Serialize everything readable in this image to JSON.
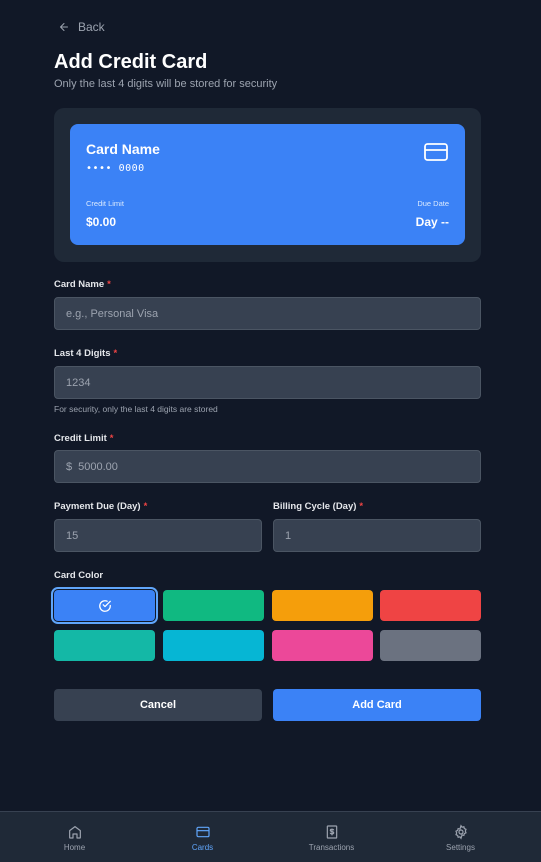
{
  "header": {
    "back_label": "Back",
    "title": "Add Credit Card",
    "subtitle": "Only the last 4 digits will be stored for security"
  },
  "preview": {
    "name": "Card Name",
    "number": "•••• 0000",
    "limit_label": "Credit Limit",
    "limit_value": "$0.00",
    "due_label": "Due Date",
    "due_value": "Day --",
    "icon": "credit-card-icon",
    "color": "#3b82f6"
  },
  "form": {
    "card_name": {
      "label": "Card Name",
      "required": "*",
      "placeholder": "e.g., Personal Visa",
      "value": ""
    },
    "last4": {
      "label": "Last 4 Digits",
      "required": "*",
      "placeholder": "1234",
      "value": "",
      "hint": "For security, only the last 4 digits are stored"
    },
    "credit_limit": {
      "label": "Credit Limit",
      "required": "*",
      "prefix": "$",
      "placeholder": "5000.00",
      "value": ""
    },
    "payment_due": {
      "label": "Payment Due (Day)",
      "required": "*",
      "placeholder": "15",
      "value": ""
    },
    "billing_cycle": {
      "label": "Billing Cycle (Day)",
      "required": "*",
      "placeholder": "1",
      "value": ""
    },
    "card_color": {
      "label": "Card Color",
      "selected_index": 0,
      "options": [
        "#3b82f6",
        "#10b981",
        "#f59e0b",
        "#ef4444",
        "#14b8a6",
        "#06b6d4",
        "#ec4899",
        "#6b7280"
      ]
    }
  },
  "actions": {
    "cancel_label": "Cancel",
    "add_label": "Add Card"
  },
  "nav": {
    "items": [
      {
        "label": "Home",
        "icon": "home-icon",
        "active": false
      },
      {
        "label": "Cards",
        "icon": "credit-card-icon",
        "active": true
      },
      {
        "label": "Transactions",
        "icon": "receipt-icon",
        "active": false
      },
      {
        "label": "Settings",
        "icon": "gear-icon",
        "active": false
      }
    ]
  }
}
